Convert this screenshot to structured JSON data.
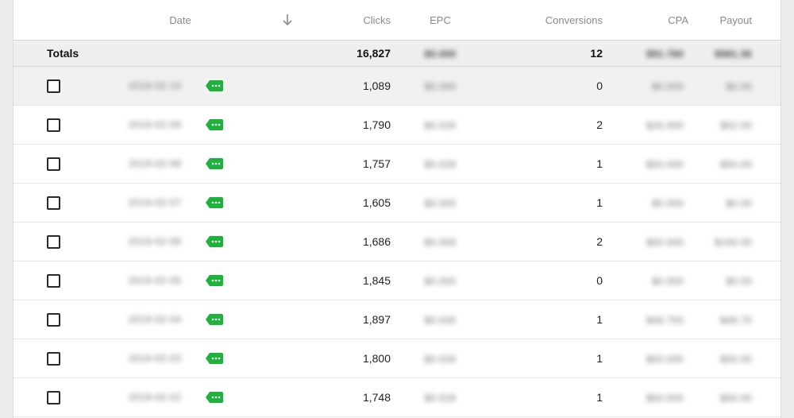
{
  "header": {
    "date": "Date",
    "clicks": "Clicks",
    "epc": "EPC",
    "conversions": "Conversions",
    "cpa": "CPA",
    "payout": "Payout",
    "sort_icon": "arrow-down-icon"
  },
  "totals": {
    "label": "Totals",
    "clicks": "16,827",
    "epc": "$0.000",
    "conversions": "12",
    "cpa": "$91.780",
    "payout": "$981.36"
  },
  "tag_icon": "tag-icon",
  "tag_color": "#1db33a",
  "rows": [
    {
      "date": "2019-02-10",
      "clicks": "1,089",
      "epc": "$0.000",
      "conversions": "0",
      "cpa": "$0.000",
      "payout": "$0.00"
    },
    {
      "date": "2019-02-09",
      "clicks": "1,790",
      "epc": "$0.029",
      "conversions": "2",
      "cpa": "$26.000",
      "payout": "$52.00"
    },
    {
      "date": "2019-02-08",
      "clicks": "1,757",
      "epc": "$0.029",
      "conversions": "1",
      "cpa": "$50.000",
      "payout": "$50.00"
    },
    {
      "date": "2019-02-07",
      "clicks": "1,605",
      "epc": "$0.000",
      "conversions": "1",
      "cpa": "$0.000",
      "payout": "$0.00"
    },
    {
      "date": "2019-02-06",
      "clicks": "1,686",
      "epc": "$0.059",
      "conversions": "2",
      "cpa": "$50.000",
      "payout": "$100.00"
    },
    {
      "date": "2019-02-05",
      "clicks": "1,845",
      "epc": "$0.000",
      "conversions": "0",
      "cpa": "$0.000",
      "payout": "$0.00"
    },
    {
      "date": "2019-02-04",
      "clicks": "1,897",
      "epc": "$0.026",
      "conversions": "1",
      "cpa": "$48.750",
      "payout": "$48.75"
    },
    {
      "date": "2019-02-03",
      "clicks": "1,800",
      "epc": "$0.028",
      "conversions": "1",
      "cpa": "$50.000",
      "payout": "$50.00"
    },
    {
      "date": "2019-02-02",
      "clicks": "1,748",
      "epc": "$0.029",
      "conversions": "1",
      "cpa": "$50.000",
      "payout": "$50.00"
    }
  ]
}
